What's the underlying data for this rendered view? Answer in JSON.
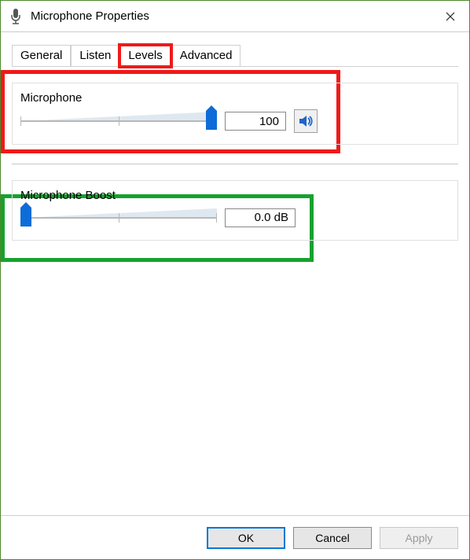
{
  "window": {
    "title": "Microphone Properties"
  },
  "tabs": [
    {
      "label": "General",
      "active": false
    },
    {
      "label": "Listen",
      "active": false
    },
    {
      "label": "Levels",
      "active": true
    },
    {
      "label": "Advanced",
      "active": false
    }
  ],
  "microphone": {
    "label": "Microphone",
    "value": "100",
    "slider_percent": 100,
    "mute_icon": "speaker-on"
  },
  "boost": {
    "label": "Microphone Boost",
    "value": "0.0 dB",
    "slider_percent": 0
  },
  "buttons": {
    "ok": "OK",
    "cancel": "Cancel",
    "apply": "Apply"
  },
  "colors": {
    "accent": "#0e6cd8",
    "annotation_red": "#ef1a1a",
    "annotation_green": "#17a22f"
  }
}
